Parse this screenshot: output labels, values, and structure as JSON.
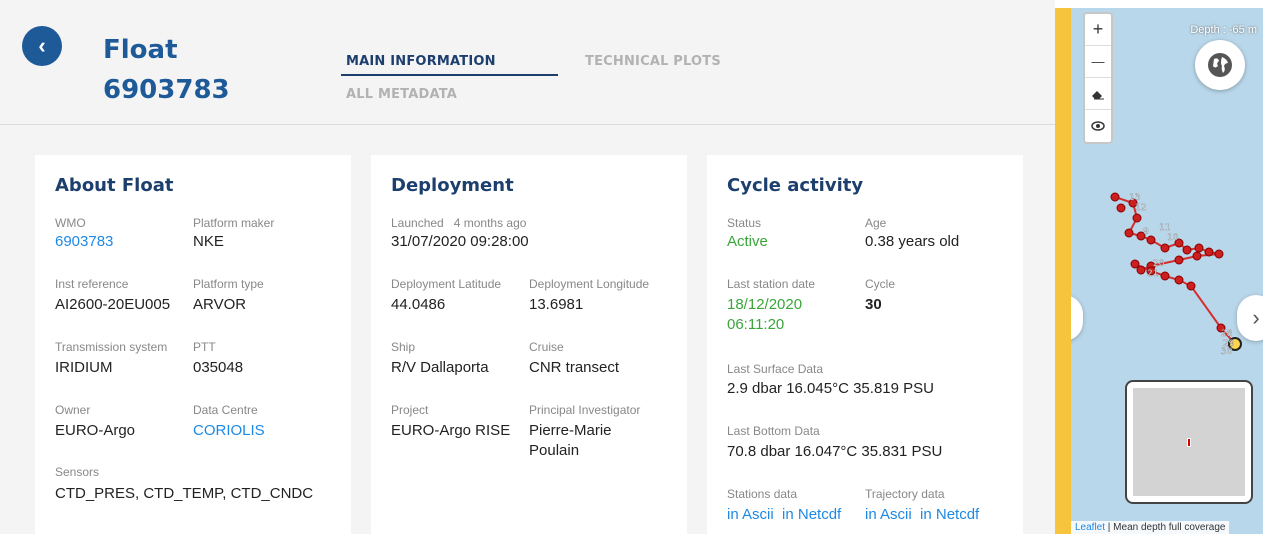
{
  "header": {
    "float_label": "Float",
    "float_id": "6903783",
    "tabs": {
      "main": "MAIN INFORMATION",
      "technical": "TECHNICAL PLOTS",
      "metadata": "ALL METADATA"
    }
  },
  "about": {
    "title": "About Float",
    "wmo_label": "WMO",
    "wmo": "6903783",
    "platform_maker_label": "Platform maker",
    "platform_maker": "NKE",
    "inst_ref_label": "Inst reference",
    "inst_ref": "AI2600-20EU005",
    "platform_type_label": "Platform type",
    "platform_type": "ARVOR",
    "transmission_label": "Transmission system",
    "transmission": "IRIDIUM",
    "ptt_label": "PTT",
    "ptt": "035048",
    "owner_label": "Owner",
    "owner": "EURO-Argo",
    "data_centre_label": "Data Centre",
    "data_centre": "CORIOLIS",
    "sensors_label": "Sensors",
    "sensors": "CTD_PRES, CTD_TEMP, CTD_CNDC"
  },
  "deployment": {
    "title": "Deployment",
    "launched_label": "Launched",
    "launched_ago": "4 months ago",
    "launched_date": "31/07/2020 09:28:00",
    "lat_label": "Deployment Latitude",
    "lat": "44.0486",
    "lon_label": "Deployment Longitude",
    "lon": "13.6981",
    "ship_label": "Ship",
    "ship": "R/V Dallaporta",
    "cruise_label": "Cruise",
    "cruise": "CNR transect",
    "project_label": "Project",
    "project": "EURO-Argo RISE",
    "pi_label": "Principal Investigator",
    "pi_line1": "Pierre-Marie",
    "pi_line2": "Poulain"
  },
  "cycle": {
    "title": "Cycle activity",
    "status_label": "Status",
    "status": "Active",
    "age_label": "Age",
    "age": "0.38 years old",
    "last_station_label": "Last station date",
    "last_station_date": "18/12/2020",
    "last_station_time": "06:11:20",
    "cycle_label": "Cycle",
    "cycle": "30",
    "surface_label": "Last Surface Data",
    "surface": "2.9 dbar 16.045°C 35.819 PSU",
    "bottom_label": "Last Bottom Data",
    "bottom": "70.8 dbar 16.047°C 35.831 PSU",
    "stations_label": "Stations data",
    "stations_ascii": "in Ascii",
    "stations_netcdf": "in Netcdf",
    "trajectory_label": "Trajectory data",
    "trajectory_ascii": "in Ascii",
    "trajectory_netcdf": "in Netcdf"
  },
  "map": {
    "depth": "Depth : -65 m",
    "zoom_in": "+",
    "zoom_out": "—",
    "attrib_leaflet": "Leaflet",
    "attrib_rest": " | Mean depth full coverage",
    "labels": [
      "13",
      "12",
      "11",
      "10",
      "9",
      "28",
      "29",
      "30",
      "20",
      "21"
    ],
    "track_color": "#d32f2f"
  },
  "colors": {
    "brand": "#1d5a97",
    "link": "#1e88e5",
    "active": "#3aa63a",
    "stripe": "#f7c53d"
  }
}
